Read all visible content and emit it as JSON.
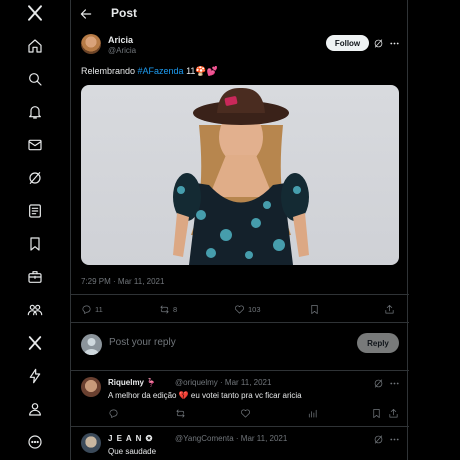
{
  "header": {
    "title": "Post"
  },
  "post": {
    "author_name": "Aricia",
    "author_handle": "@Aricia",
    "follow_label": "Follow",
    "text_prefix": "Relembrando ",
    "hashtag": "#AFazenda",
    "text_suffix": " 11",
    "text_emoji": "🍄💕",
    "timestamp": "7:29 PM · Mar 11, 2021",
    "stats": {
      "replies": "11",
      "reposts": "8",
      "likes": "103"
    }
  },
  "reply_box": {
    "placeholder": "Post your reply",
    "button_label": "Reply"
  },
  "comments": [
    {
      "name": "Riquelmy",
      "name_emoji": "🦩",
      "meta": "@oriquelmy · Mar 11, 2021",
      "text_prefix": "A melhor da edição ",
      "text_emoji": "💔",
      "text_suffix": " eu votei tanto pra vc ficar aricia"
    },
    {
      "name": "J E A N",
      "name_emoji": "✪",
      "meta": "@YangComenta · Mar 11, 2021",
      "text_prefix": "Que saudade",
      "text_emoji": "",
      "text_suffix": ""
    }
  ],
  "icons": {
    "nav": [
      "x-logo-icon",
      "home-icon",
      "search-icon",
      "bell-icon",
      "mail-icon",
      "grok-icon",
      "lists-icon",
      "bookmark-icon",
      "jobs-icon",
      "communities-icon",
      "premium-x-icon",
      "verified-orgs-icon",
      "profile-icon",
      "more-circle-icon"
    ]
  },
  "colors": {
    "accent": "#1d9bf0",
    "background": "#000000",
    "border": "#2f3336",
    "muted": "#71767b"
  }
}
